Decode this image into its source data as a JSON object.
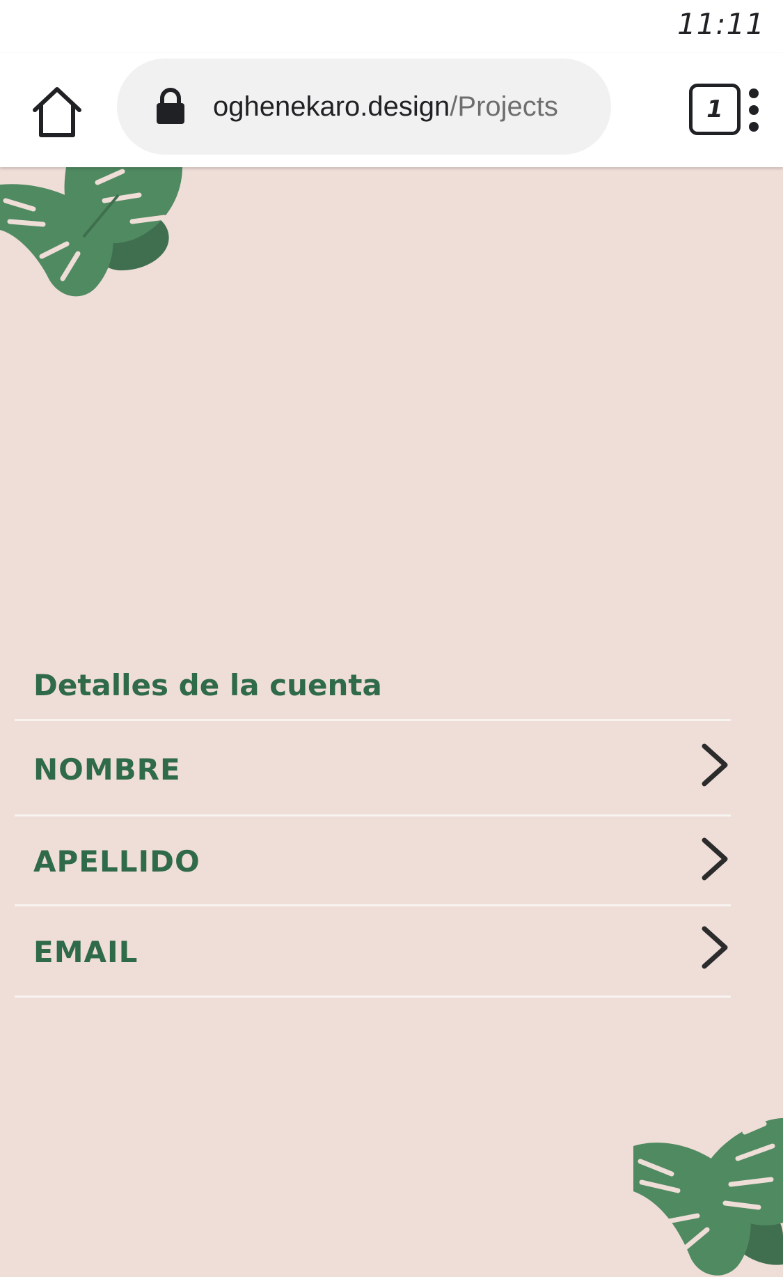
{
  "status_bar": {
    "time": "11:11"
  },
  "browser": {
    "url_domain": "oghenekaro.design",
    "url_path": "/Projects",
    "tab_count": "1",
    "icons": {
      "home": "home-icon",
      "lock": "lock-icon",
      "tabs": "tab-switcher-icon",
      "menu": "more-vert-icon"
    }
  },
  "page": {
    "section_title": "Detalles de la cuenta",
    "rows": [
      {
        "label": "NOMBRE",
        "icon": "chevron-right-icon"
      },
      {
        "label": "APELLIDO",
        "icon": "chevron-right-icon"
      },
      {
        "label": "EMAIL",
        "icon": "chevron-right-icon"
      }
    ],
    "decorations": [
      "monstera-leaf-icon",
      "monstera-leaf-icon"
    ]
  },
  "colors": {
    "background": "#efddd7",
    "accent_green": "#2f6a49",
    "leaf_green": "#4f8a61",
    "leaf_shadow": "#3f6f4e",
    "divider": "#f7f3f1",
    "toolbar": "#ffffff",
    "omnibox": "#f1f1f1"
  }
}
